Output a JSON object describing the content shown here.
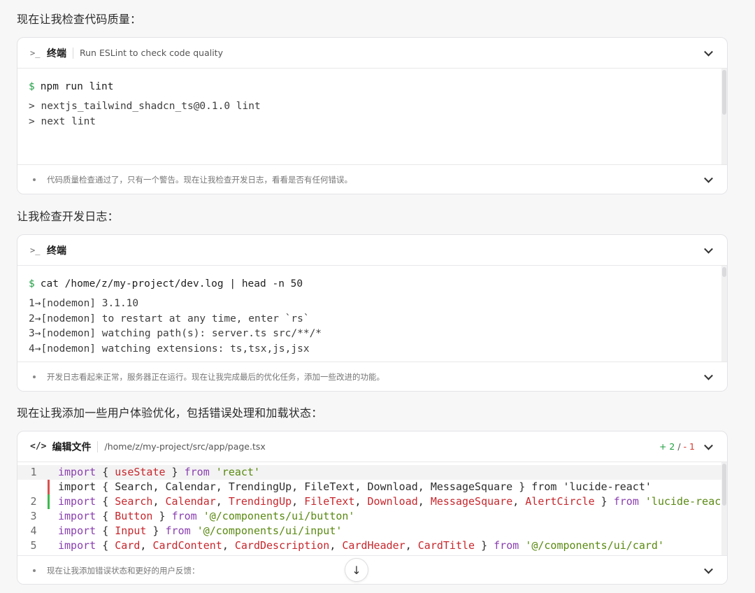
{
  "sections": [
    {
      "heading": "现在让我检查代码质量：",
      "card": {
        "type": "terminal",
        "title": "终端",
        "subtitle": "Run ESLint to check code quality",
        "command": "npm run lint",
        "output": [
          "> nextjs_tailwind_shadcn_ts@0.1.0 lint",
          "> next lint"
        ],
        "footer": "代码质量检查通过了，只有一个警告。现在让我检查开发日志，看看是否有任何错误。"
      }
    },
    {
      "heading": "让我检查开发日志：",
      "card": {
        "type": "terminal",
        "title": "终端",
        "command": "cat /home/z/my-project/dev.log | head -n 50",
        "output": [
          "1→[nodemon] 3.1.10",
          "2→[nodemon] to restart at any time, enter `rs`",
          "3→[nodemon] watching path(s): server.ts src/**/*",
          "4→[nodemon] watching extensions: ts,tsx,js,jsx"
        ],
        "footer": "开发日志看起来正常，服务器正在运行。现在让我完成最后的优化任务，添加一些改进的功能。"
      }
    },
    {
      "heading": "现在让我添加一些用户体验优化，包括错误处理和加载状态：",
      "card": {
        "type": "edit",
        "title": "编辑文件",
        "path": "/home/z/my-project/src/app/page.tsx",
        "added": "+ 2",
        "slash": "/",
        "removed": "- 1",
        "footer": "现在让我添加错误状态和更好的用户反馈："
      }
    }
  ],
  "code_lines": [
    {
      "ln": "1",
      "diff": "none",
      "hl": true,
      "tokens": [
        [
          "kw",
          "import"
        ],
        [
          "pun",
          " { "
        ],
        [
          "id",
          "useState"
        ],
        [
          "pun",
          " } "
        ],
        [
          "kw",
          "from"
        ],
        [
          "pun",
          " "
        ],
        [
          "str",
          "'react'"
        ]
      ]
    },
    {
      "ln": "",
      "diff": "removed",
      "hl": false,
      "tokens": [
        [
          "plain",
          "import { Search, Calendar, TrendingUp, FileText, Download, MessageSquare } from 'lucide-react'"
        ]
      ]
    },
    {
      "ln": "2",
      "diff": "added",
      "hl": false,
      "tokens": [
        [
          "kw",
          "import"
        ],
        [
          "pun",
          " { "
        ],
        [
          "id",
          "Search"
        ],
        [
          "pun",
          ", "
        ],
        [
          "id",
          "Calendar"
        ],
        [
          "pun",
          ", "
        ],
        [
          "id",
          "TrendingUp"
        ],
        [
          "pun",
          ", "
        ],
        [
          "id",
          "FileText"
        ],
        [
          "pun",
          ", "
        ],
        [
          "id",
          "Download"
        ],
        [
          "pun",
          ", "
        ],
        [
          "id",
          "MessageSquare"
        ],
        [
          "pun",
          ", "
        ],
        [
          "id",
          "AlertCircle"
        ],
        [
          "pun",
          " } "
        ],
        [
          "kw",
          "from"
        ],
        [
          "pun",
          " "
        ],
        [
          "str",
          "'lucide-react'"
        ]
      ]
    },
    {
      "ln": "3",
      "diff": "none",
      "hl": false,
      "tokens": [
        [
          "kw",
          "import"
        ],
        [
          "pun",
          " { "
        ],
        [
          "id",
          "Button"
        ],
        [
          "pun",
          " } "
        ],
        [
          "kw",
          "from"
        ],
        [
          "pun",
          " "
        ],
        [
          "str",
          "'@/components/ui/button'"
        ]
      ]
    },
    {
      "ln": "4",
      "diff": "none",
      "hl": false,
      "tokens": [
        [
          "kw",
          "import"
        ],
        [
          "pun",
          " { "
        ],
        [
          "id",
          "Input"
        ],
        [
          "pun",
          " } "
        ],
        [
          "kw",
          "from"
        ],
        [
          "pun",
          " "
        ],
        [
          "str",
          "'@/components/ui/input'"
        ]
      ]
    },
    {
      "ln": "5",
      "diff": "none",
      "hl": false,
      "tokens": [
        [
          "kw",
          "import"
        ],
        [
          "pun",
          " { "
        ],
        [
          "id",
          "Card"
        ],
        [
          "pun",
          ", "
        ],
        [
          "id",
          "CardContent"
        ],
        [
          "pun",
          ", "
        ],
        [
          "id",
          "CardDescription"
        ],
        [
          "pun",
          ", "
        ],
        [
          "id",
          "CardHeader"
        ],
        [
          "pun",
          ", "
        ],
        [
          "id",
          "CardTitle"
        ],
        [
          "pun",
          " } "
        ],
        [
          "kw",
          "from"
        ],
        [
          "pun",
          " "
        ],
        [
          "str",
          "'@/components/ui/card'"
        ]
      ]
    }
  ],
  "colors": {
    "removed_marker": "#d9534f",
    "added_marker": "#3fb950",
    "prompt": "#23a047"
  },
  "icons": {
    "terminal": "terminal-icon",
    "code": "code-icon",
    "chevron": "chevron-down-icon",
    "scroll_down": "arrow-down-icon"
  }
}
